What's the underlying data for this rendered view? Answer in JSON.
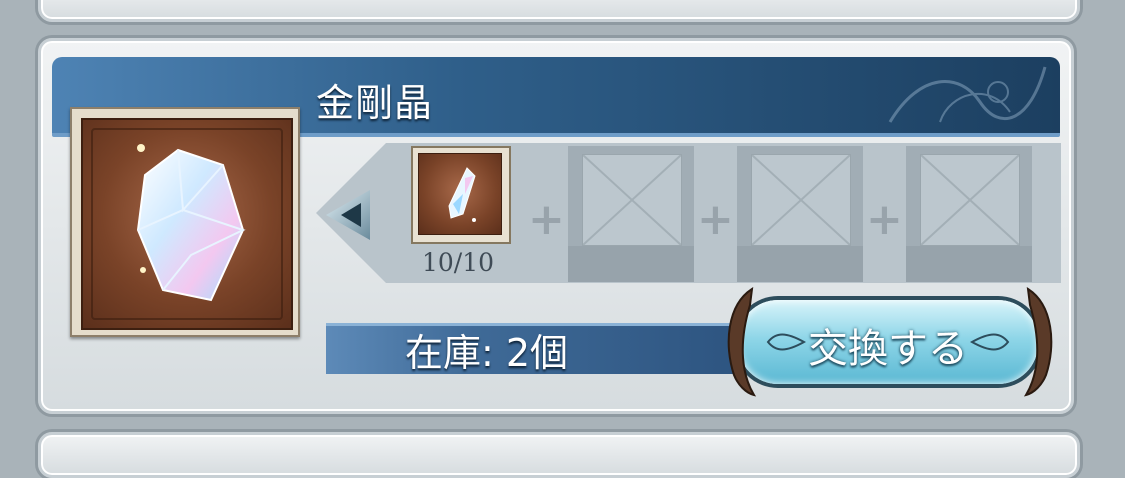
{
  "item": {
    "name": "金剛晶",
    "icon": "crystal-icon"
  },
  "recipe": {
    "materials": [
      {
        "icon": "crystal-shard-icon",
        "count": "10/10"
      },
      {
        "icon": "empty-slot-icon",
        "count": ""
      },
      {
        "icon": "empty-slot-icon",
        "count": ""
      },
      {
        "icon": "empty-slot-icon",
        "count": ""
      }
    ],
    "plus_symbol": "+"
  },
  "stock": {
    "text": "在庫: 2個"
  },
  "actions": {
    "exchange_label": "交換する"
  },
  "colors": {
    "header_bar": "#2f5f8a",
    "button": "#8fd6e8",
    "card": "#e4e8ea"
  }
}
